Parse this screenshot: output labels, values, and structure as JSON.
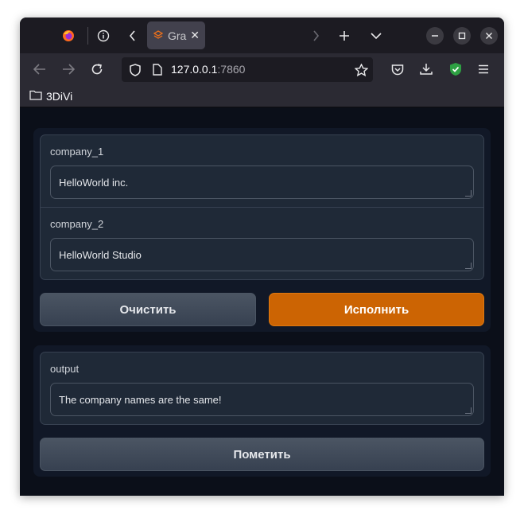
{
  "browser": {
    "tab_title": "Gra",
    "url_host": "127.0.0.1",
    "url_port": ":7860",
    "bookmark_label": "3DiVi",
    "icons": {
      "firefox": "firefox-icon",
      "info": "info-icon",
      "back_tab": "chevron-left-icon",
      "forward_tab": "chevron-right-icon",
      "new_tab": "plus-icon",
      "list_tabs": "chevron-down-icon",
      "minimize": "minimize-icon",
      "maximize": "maximize-icon",
      "close": "close-icon"
    }
  },
  "app": {
    "inputs": [
      {
        "label": "company_1",
        "value": "HelloWorld inc."
      },
      {
        "label": "company_2",
        "value": "HelloWorld Studio"
      }
    ],
    "clear_label": "Очистить",
    "submit_label": "Исполнить",
    "output": {
      "label": "output",
      "value": "The company names are the same!"
    },
    "flag_label": "Пометить",
    "accent_color": "#cc6403"
  }
}
